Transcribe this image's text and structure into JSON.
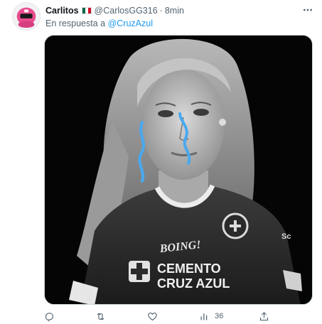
{
  "tweet": {
    "author_name": "Carlitos",
    "author_flag": "mexico-flag",
    "handle": "@CarlosGG316",
    "separator": "·",
    "time": "8min",
    "reply_prefix": "En respuesta a",
    "reply_handle": "@CruzAzul",
    "media": {
      "jersey_sponsor_top": "BOING!",
      "jersey_sponsor_line1": "CEMENTO",
      "jersey_sponsor_line2": "CRUZ AZUL",
      "jersey_side_text": "Sc"
    },
    "actions": {
      "reply_icon": "reply-icon",
      "retweet_icon": "retweet-icon",
      "like_icon": "heart-icon",
      "views_icon": "views-icon",
      "views_count": "36",
      "share_icon": "share-icon"
    }
  },
  "colors": {
    "accent": "#1d9bf0",
    "secondary_text": "#536471",
    "tear": "#49a9ef",
    "avatar_pink": "#e94d8f"
  }
}
